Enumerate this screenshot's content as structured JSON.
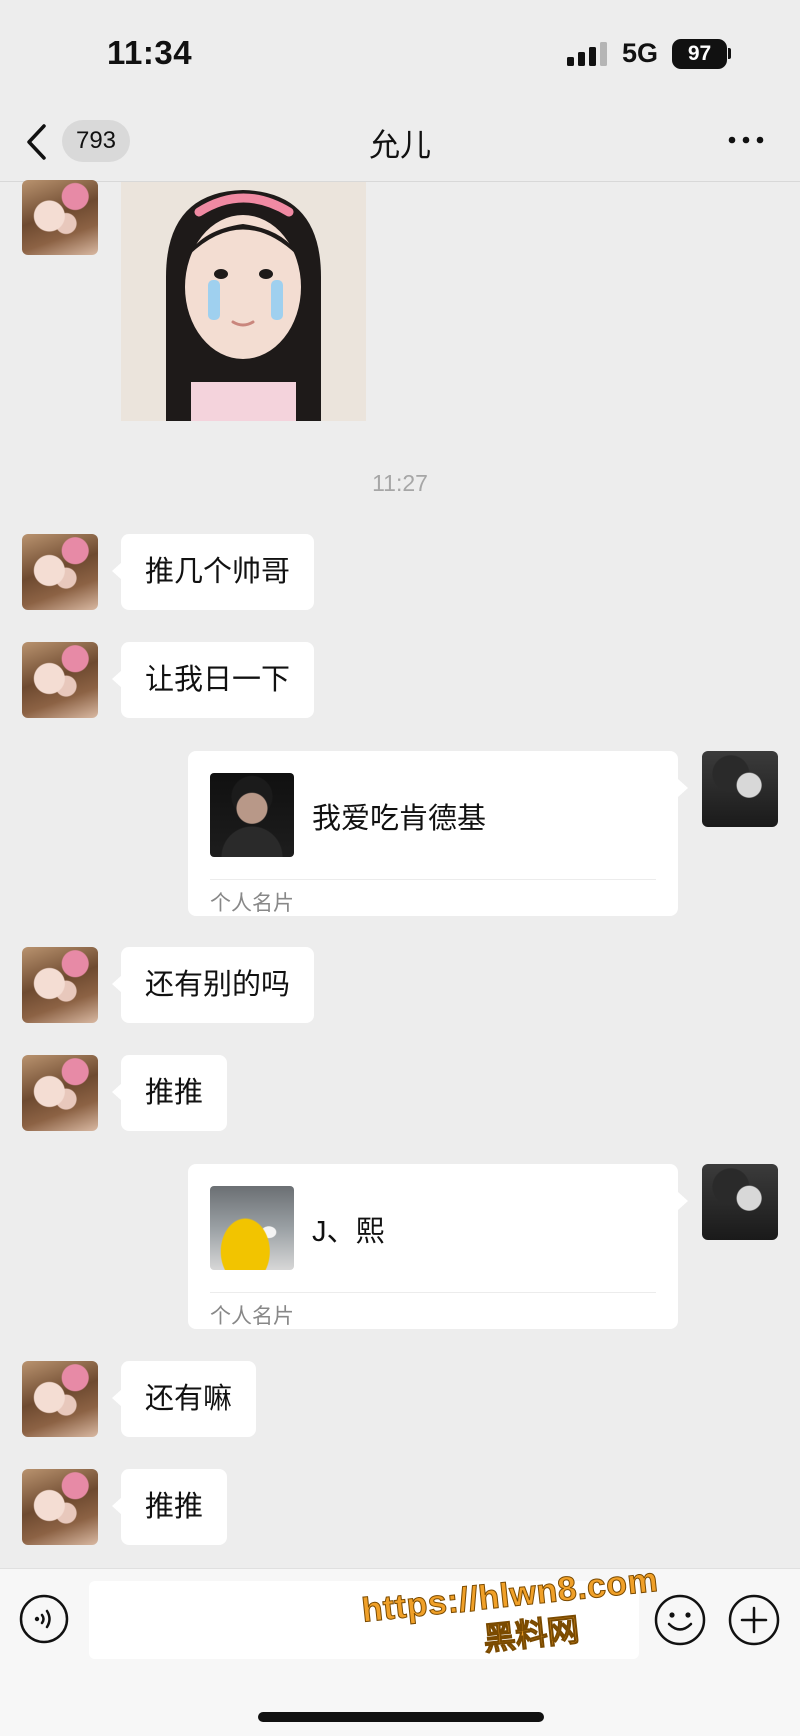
{
  "status_bar": {
    "time": "11:34",
    "network": "5G",
    "battery": "97"
  },
  "nav": {
    "unread_count": "793",
    "title": "允儿"
  },
  "messages": {
    "timestamp": "11:27",
    "m1": "推几个帅哥",
    "m2": "让我日一下",
    "card1": {
      "name": "我爱吃肯德基",
      "type": "个人名片"
    },
    "m3": "还有别的吗",
    "m4": "推推",
    "card2": {
      "name": "J、熙",
      "type": "个人名片"
    },
    "m5": "还有嘛",
    "m6": "推推"
  },
  "input": {
    "placeholder": ""
  },
  "watermark": {
    "url": "https://hlwn8.com",
    "name": "黑料网"
  },
  "colors": {
    "background": "#ededed",
    "bubble": "#ffffff",
    "watermark": "#f0a028"
  }
}
